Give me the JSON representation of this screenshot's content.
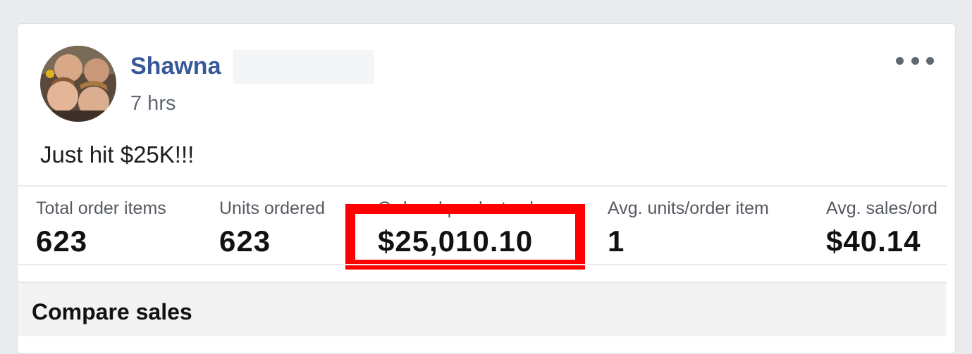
{
  "post": {
    "author": "Shawna",
    "time": "7 hrs",
    "text": "Just hit $25K!!!"
  },
  "metrics": [
    {
      "label": "Total order items",
      "value": "623"
    },
    {
      "label": "Units ordered",
      "value": "623"
    },
    {
      "label": "Ordered product sales",
      "value": "$25,010.10"
    },
    {
      "label": "Avg. units/order item",
      "value": "1"
    },
    {
      "label": "Avg. sales/ord",
      "value": "$40.14"
    }
  ],
  "compare": {
    "title": "Compare sales"
  },
  "colors": {
    "author_link": "#385898",
    "highlight_box": "#ff0000",
    "page_bg": "#e9ebee"
  },
  "icons": {
    "more": "more-options-icon"
  }
}
